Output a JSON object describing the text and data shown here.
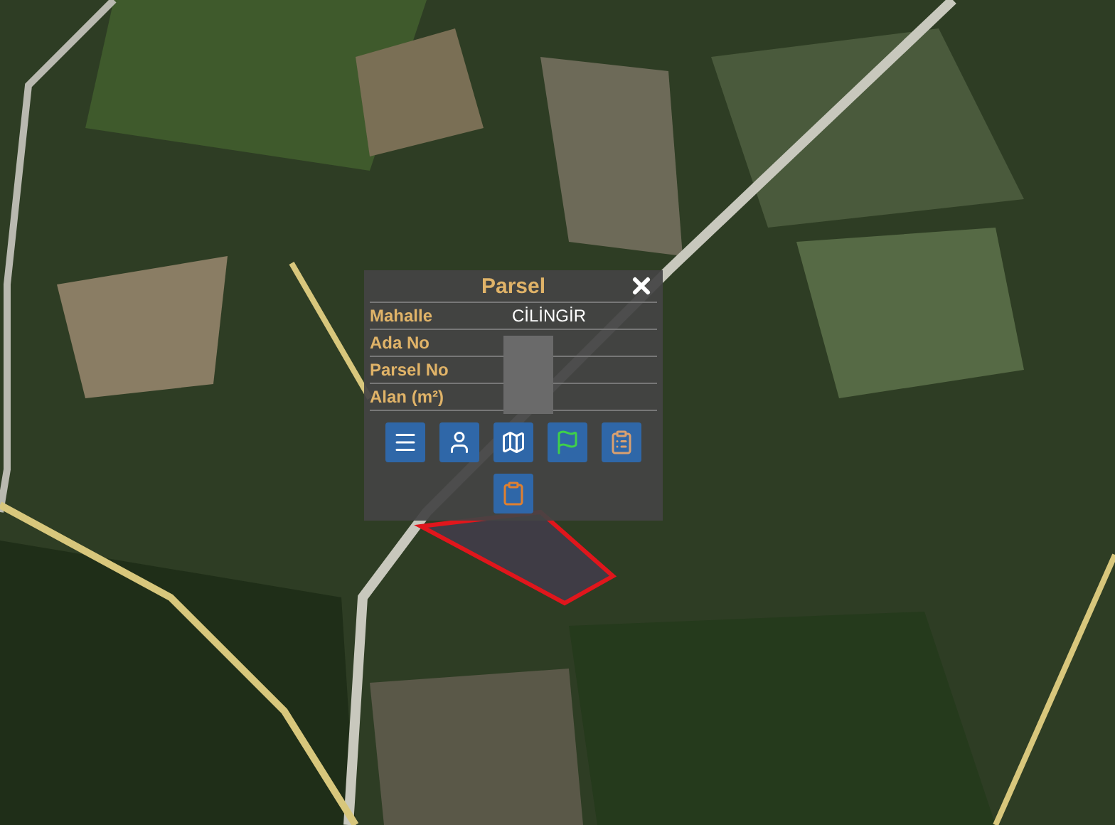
{
  "popup": {
    "title": "Parsel",
    "rows": [
      {
        "label": "Mahalle",
        "value": "CİLİNGİR"
      },
      {
        "label": "Ada No"
      },
      {
        "label": "Parsel No"
      },
      {
        "label": "Alan (m²)"
      }
    ]
  }
}
